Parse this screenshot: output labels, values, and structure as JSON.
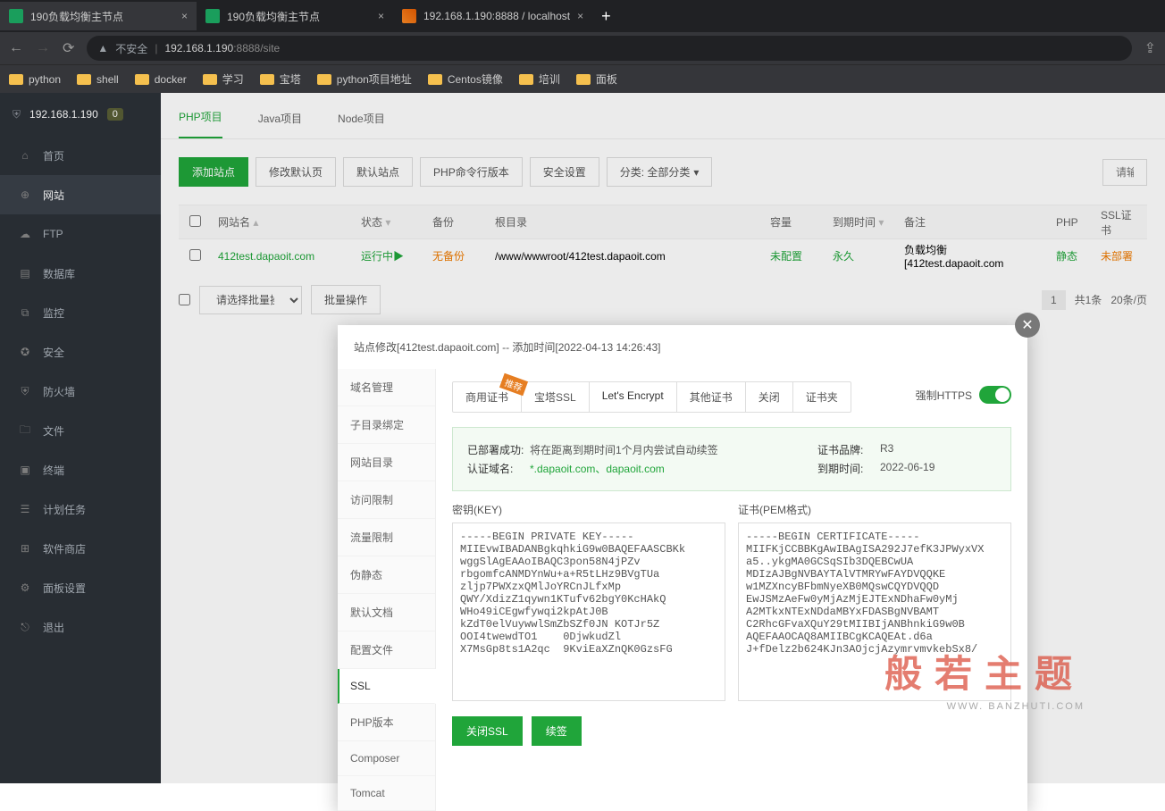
{
  "browser": {
    "tabs": [
      {
        "title": "190负载均衡主节点",
        "active": true,
        "fav": "green"
      },
      {
        "title": "190负载均衡主节点",
        "active": false,
        "fav": "green"
      },
      {
        "title": "192.168.1.190:8888 / localhost",
        "active": false,
        "fav": "orange"
      }
    ],
    "url_insecure_label": "不安全",
    "url_host": "192.168.1.190",
    "url_port": ":8888",
    "url_path": "/site",
    "bookmarks": [
      "python",
      "shell",
      "docker",
      "学习",
      "宝塔",
      "python项目地址",
      "Centos镜像",
      "培训",
      "面板"
    ]
  },
  "sidebar": {
    "host": "192.168.1.190",
    "badge": "0",
    "items": [
      {
        "label": "首页",
        "icon": "⌂"
      },
      {
        "label": "网站",
        "icon": "⊕",
        "active": true
      },
      {
        "label": "FTP",
        "icon": "☁"
      },
      {
        "label": "数据库",
        "icon": "▤"
      },
      {
        "label": "监控",
        "icon": "⧉"
      },
      {
        "label": "安全",
        "icon": "✪"
      },
      {
        "label": "防火墙",
        "icon": "⛨"
      },
      {
        "label": "文件",
        "icon": "🗀"
      },
      {
        "label": "终端",
        "icon": "▣"
      },
      {
        "label": "计划任务",
        "icon": "☰"
      },
      {
        "label": "软件商店",
        "icon": "⊞"
      },
      {
        "label": "面板设置",
        "icon": "⚙"
      },
      {
        "label": "退出",
        "icon": "⎋"
      }
    ]
  },
  "main": {
    "tabs": [
      {
        "label": "PHP项目",
        "active": true
      },
      {
        "label": "Java项目"
      },
      {
        "label": "Node项目"
      }
    ],
    "toolbar": {
      "add": "添加站点",
      "modify_default": "修改默认页",
      "default_site": "默认站点",
      "php_cli": "PHP命令行版本",
      "security": "安全设置",
      "category": "分类: 全部分类",
      "search_ph": "请输入"
    },
    "columns": {
      "name": "网站名",
      "status": "状态",
      "backup": "备份",
      "root": "根目录",
      "capacity": "容量",
      "expiry": "到期时间",
      "note": "备注",
      "php": "PHP",
      "ssl": "SSL证书"
    },
    "rows": [
      {
        "name": "412test.dapaoit.com",
        "status": "运行中",
        "status_icon": "▶",
        "backup": "无备份",
        "root": "/www/wwwroot/412test.dapaoit.com",
        "capacity": "未配置",
        "expiry": "永久",
        "note": "负载均衡[412test.dapaoit.com",
        "php": "静态",
        "ssl": "未部署"
      }
    ],
    "batch_ph": "请选择批量操作",
    "batch_btn": "批量操作",
    "page_current": "1",
    "page_total": "共1条",
    "page_size": "20条/页"
  },
  "modal": {
    "title": "站点修改[412test.dapaoit.com] -- 添加时间[2022-04-13 14:26:43]",
    "side": [
      "域名管理",
      "子目录绑定",
      "网站目录",
      "访问限制",
      "流量限制",
      "伪静态",
      "默认文档",
      "配置文件",
      "SSL",
      "PHP版本",
      "Composer",
      "Tomcat"
    ],
    "side_active": "SSL",
    "ssl_tabs": [
      "商用证书",
      "宝塔SSL",
      "Let's Encrypt",
      "其他证书",
      "关闭",
      "证书夹"
    ],
    "ssl_tab_active": "Let's Encrypt",
    "recommend_ribbon": "推荐",
    "force_https_label": "强制HTTPS",
    "info": {
      "deploy_label": "已部署成功:",
      "deploy_value": "将在距离到期时间1个月内尝试自动续签",
      "domain_label": "认证域名:",
      "domain_value": "*.dapaoit.com、dapaoit.com",
      "brand_label": "证书品牌:",
      "brand_value": "R3",
      "expiry_label": "到期时间:",
      "expiry_value": "2022-06-19"
    },
    "key_label": "密钥(KEY)",
    "pem_label": "证书(PEM格式)",
    "key_text": "-----BEGIN PRIVATE KEY-----\nMIIEvwIBADANBgkqhkiG9w0BAQEFAASCBKk\nwggSlAgEAAoIBAQC3pon58N4jPZv\nrbgomfcANMDYnWu+a+R5tLHz9BVgTUa\nzljp7PWXzxQMlJoYRCnJLfxMp\nQWY/XdizZ1qywn1KTufv62bgY0KcHAkQ\nWHo49iCEgwfywqi2kpAtJ0B\nkZdT0elVuywwlSmZbSZf0JN KOTJr5Z\nOOI4twewdTO1    0DjwkudZl\nX7MsGp8ts1A2qc  9KviEaXZnQK0GzsFG",
    "pem_text": "-----BEGIN CERTIFICATE-----\nMIIFKjCCBBKgAwIBAgISA292J7efK3JPWyxVX\na5..ykgMA0GCSqSIb3DQEBCwUA\nMDIzAJBgNVBAYTAlVTMRYwFAYDVQQKE\nw1MZXncyBFbmNyeXB0MQswCQYDVQQD\nEwJSMzAeFw0yMjAzMjEJTExNDhaFw0yMj\nA2MTkxNTExNDdaMBYxFDASBgNVBAMT\nC2RhcGFvaXQuY29tMIIBIjANBhnkiG9w0B\nAQEFAAOCAQ8AMIIBCgKCAQEAt.d6a\nJ+fDelz2b624KJn3AOjcjAzymrvmvkebSx8/",
    "actions": {
      "close_ssl": "关闭SSL",
      "renew": "续签"
    }
  },
  "watermark": {
    "main": "般若主题",
    "sub": "WWW.  BANZHUTI.COM"
  }
}
